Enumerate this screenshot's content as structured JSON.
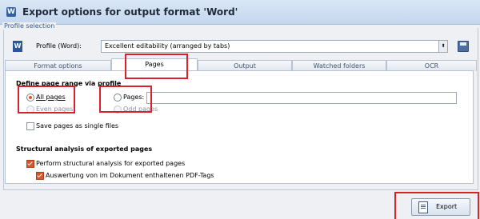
{
  "window": {
    "title": "Export options for output format 'Word'"
  },
  "profile": {
    "group_label": "Profile selection",
    "label": "Profile (Word):",
    "selected": "Excellent editability (arranged by tabs)",
    "word_icon": "W"
  },
  "tabs": [
    {
      "label": "Format options",
      "active": false
    },
    {
      "label": "Pages",
      "active": true
    },
    {
      "label": "Output",
      "active": false
    },
    {
      "label": "Watched folders",
      "active": false
    },
    {
      "label": "OCR",
      "active": false
    }
  ],
  "page_range": {
    "heading": "Define page range via profile",
    "all_pages": "All pages",
    "even_pages": "Even pages",
    "pages": "Pages:",
    "pages_value": "",
    "odd_pages": "Odd pages",
    "save_single": "Save pages as single files",
    "selected_option": "All pages"
  },
  "structural": {
    "heading": "Structural analysis of exported pages",
    "perform": "Perform structural analysis for exported pages",
    "pdf_tags": "Auswertung von im Dokument enthaltenen PDF-Tags"
  },
  "footer": {
    "export_label": "Export"
  },
  "colors": {
    "accent": "#d4582b",
    "highlight": "#d9202b",
    "word_blue": "#2b579a"
  }
}
